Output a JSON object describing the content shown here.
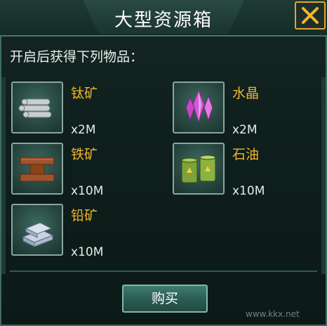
{
  "dialog": {
    "title": "大型资源箱",
    "subtitle": "开启后获得下列物品："
  },
  "items": [
    {
      "name": "钛矿",
      "qty": "x2M",
      "icon": "titanium-rods-icon"
    },
    {
      "name": "水晶",
      "qty": "x2M",
      "icon": "crystal-icon"
    },
    {
      "name": "铁矿",
      "qty": "x10M",
      "icon": "iron-beam-icon"
    },
    {
      "name": "石油",
      "qty": "x10M",
      "icon": "oil-barrels-icon"
    },
    {
      "name": "铅矿",
      "qty": "x10M",
      "icon": "lead-ingots-icon"
    }
  ],
  "buy_button": {
    "label": "购买"
  },
  "watermark": {
    "text": "www.kkx.net"
  },
  "colors": {
    "accent": "#f2b629",
    "border": "#44776d",
    "background": "#0c1a17"
  }
}
